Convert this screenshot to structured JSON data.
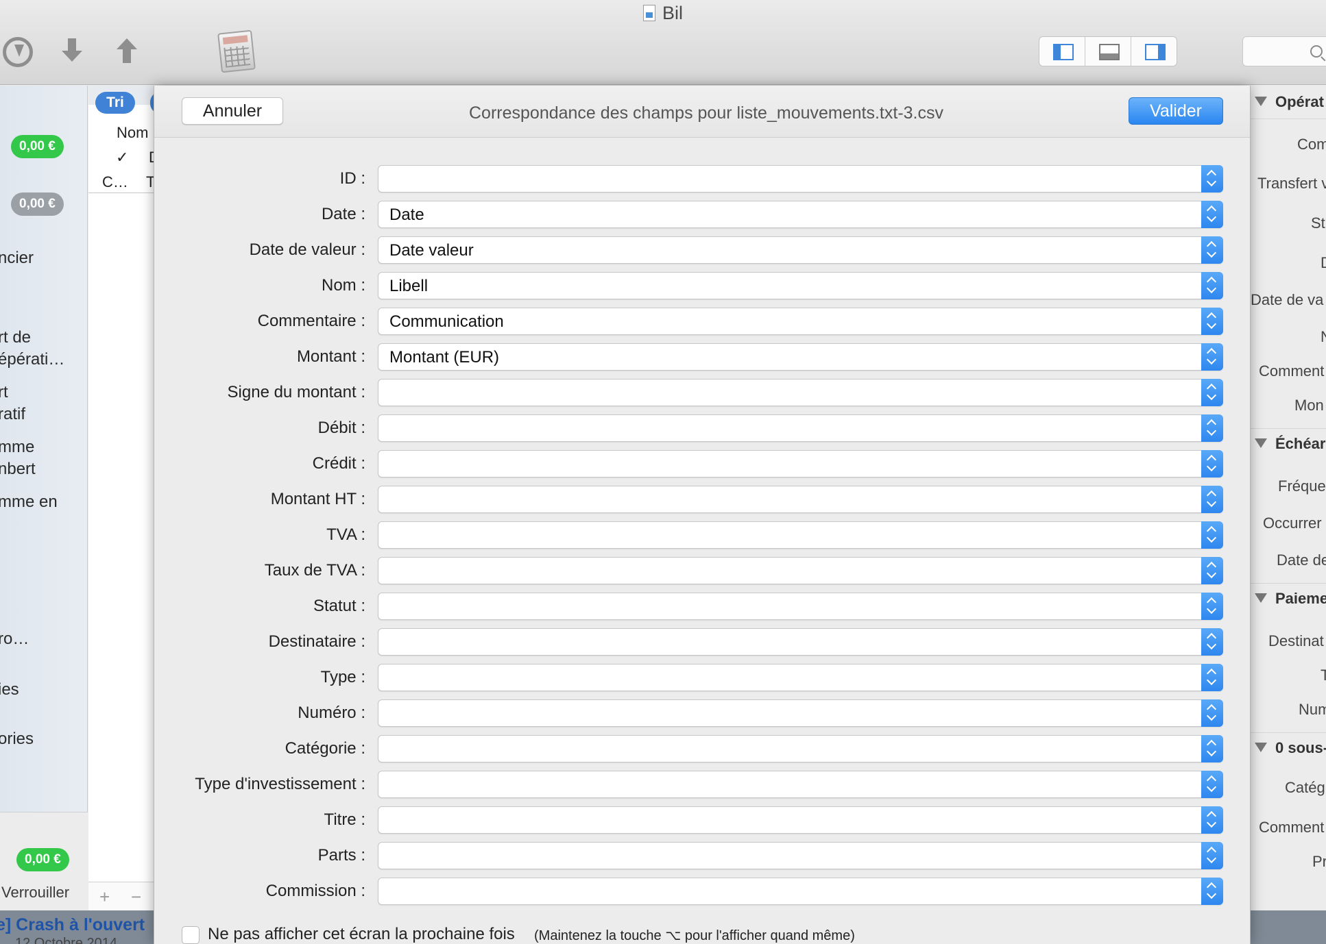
{
  "window": {
    "title": "Bil"
  },
  "sidebar": {
    "badges": [
      "0,00 €",
      "0,00 €",
      "0,00 €"
    ],
    "items": [
      "ncier",
      "rt de\népérati…",
      "rt\nratif",
      "mme\nnbert",
      "mme en",
      "ro…",
      "ies",
      "ories"
    ],
    "lock_label": "Verrouiller"
  },
  "list": {
    "sort_label": "Tri",
    "col_name": "Nom",
    "check": "✓",
    "col_d": "D",
    "row_c": "C…",
    "row_t": "T",
    "add": "+",
    "remove": "−"
  },
  "inspector": {
    "sections": [
      "Opérat",
      "Échéar",
      "Paieme",
      "0 sous-"
    ],
    "labels": [
      "Com",
      "Transfert v",
      "St",
      "D",
      "Date de va",
      "N",
      "Comment",
      "Mon",
      "Fréque",
      "Occurrer",
      "Date de",
      "Destinat",
      "T",
      "Num",
      "Catég",
      "Comment",
      "Pr"
    ]
  },
  "bottom": {
    "link_text": "e] Crash à l'ouvert",
    "sub_text": "12 Octobre 2014"
  },
  "dialog": {
    "cancel_label": "Annuler",
    "confirm_label": "Valider",
    "title": "Correspondance des champs pour liste_mouvements.txt-3.csv",
    "fields": [
      {
        "label": "ID :",
        "value": ""
      },
      {
        "label": "Date :",
        "value": "Date"
      },
      {
        "label": "Date de valeur :",
        "value": "Date valeur"
      },
      {
        "label": "Nom :",
        "value": "Libell"
      },
      {
        "label": "Commentaire :",
        "value": "Communication"
      },
      {
        "label": "Montant :",
        "value": "Montant (EUR)"
      },
      {
        "label": "Signe du montant :",
        "value": ""
      },
      {
        "label": "Débit :",
        "value": ""
      },
      {
        "label": "Crédit :",
        "value": ""
      },
      {
        "label": "Montant HT :",
        "value": ""
      },
      {
        "label": "TVA :",
        "value": ""
      },
      {
        "label": "Taux de TVA :",
        "value": ""
      },
      {
        "label": "Statut :",
        "value": ""
      },
      {
        "label": "Destinataire :",
        "value": ""
      },
      {
        "label": "Type :",
        "value": ""
      },
      {
        "label": "Numéro :",
        "value": ""
      },
      {
        "label": "Catégorie :",
        "value": ""
      },
      {
        "label": "Type d'investissement :",
        "value": ""
      },
      {
        "label": "Titre :",
        "value": ""
      },
      {
        "label": "Parts :",
        "value": ""
      },
      {
        "label": "Commission :",
        "value": ""
      }
    ],
    "dont_show_label": "Ne pas afficher cet écran la prochaine fois",
    "dont_show_hint": "(Maintenez la touche ⌥ pour l'afficher quand même)"
  },
  "colors": {
    "accent": "#2e87ef",
    "badge_green": "#33c84a",
    "badge_grey": "#9aa0a6"
  }
}
